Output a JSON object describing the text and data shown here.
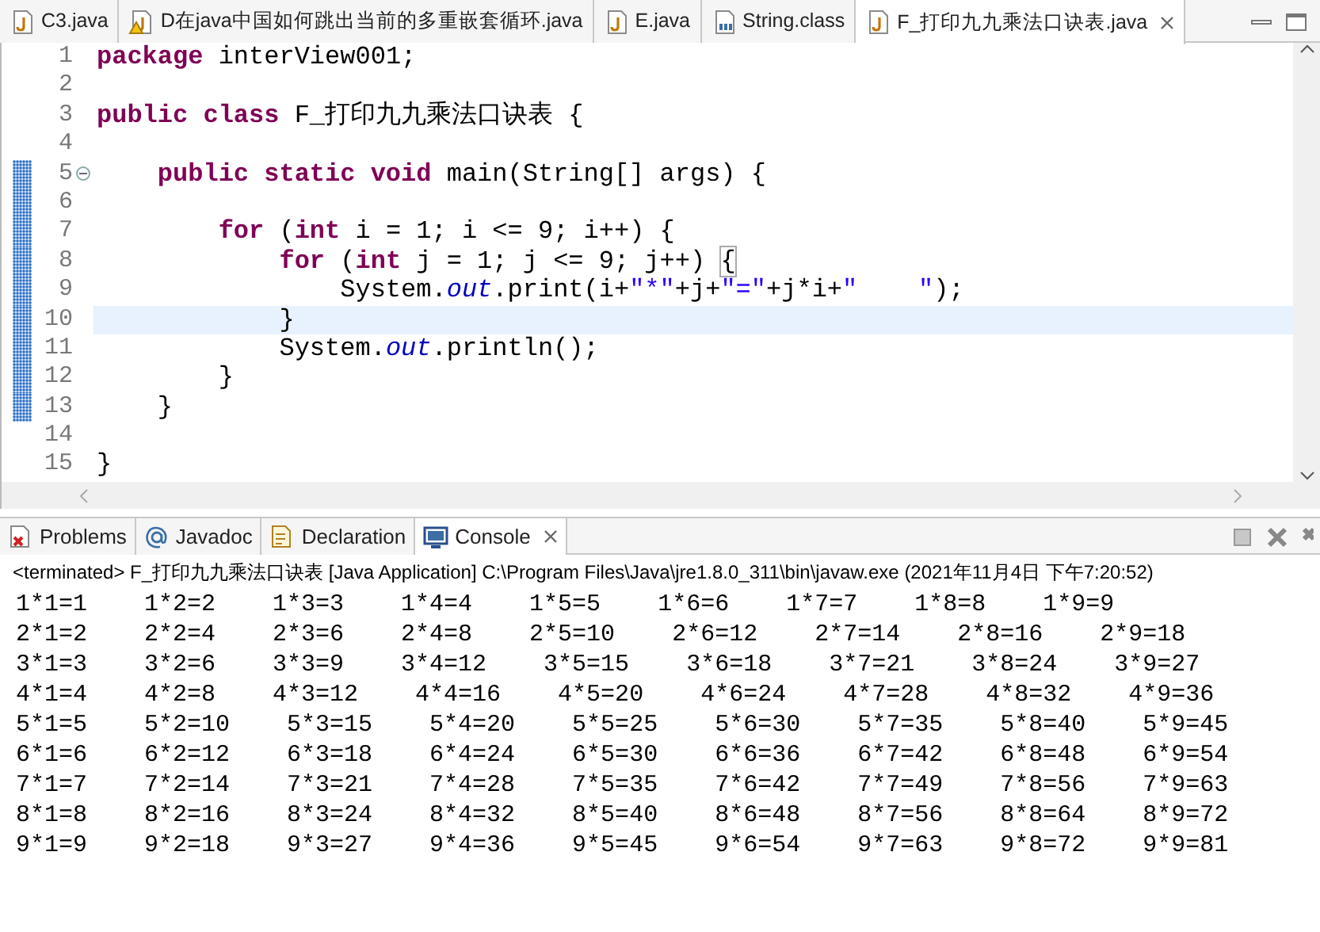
{
  "editor_tabs": [
    {
      "label": "C3.java",
      "kind": "java",
      "selected": false
    },
    {
      "label": "D在java中国如何跳出当前的多重嵌套循环.java",
      "kind": "java-warning",
      "selected": false
    },
    {
      "label": "E.java",
      "kind": "java",
      "selected": false
    },
    {
      "label": "String.class",
      "kind": "class",
      "selected": false
    },
    {
      "label": "F_打印九九乘法口诀表.java",
      "kind": "java",
      "selected": true
    }
  ],
  "code_lines": [
    {
      "number": "1",
      "selected": false,
      "range_marker": false,
      "tokens": [
        {
          "kind": "keyword",
          "text": "package"
        },
        {
          "kind": "plain",
          "text": " interView001;"
        }
      ]
    },
    {
      "number": "2",
      "selected": false,
      "range_marker": false
    },
    {
      "number": "3",
      "selected": false,
      "range_marker": false,
      "tokens": [
        {
          "kind": "keyword",
          "text": "public class"
        },
        {
          "kind": "plain",
          "text": " F_打印九九乘法口诀表 {"
        }
      ]
    },
    {
      "number": "4",
      "selected": false,
      "range_marker": false
    },
    {
      "number": "5",
      "selected": false,
      "range_marker": true,
      "expanded": true,
      "tokens": [
        {
          "kind": "keyword",
          "text": "    public static void"
        },
        {
          "kind": "plain",
          "text": " main(String[] args) {"
        }
      ]
    },
    {
      "number": "6",
      "selected": false,
      "range_marker": true
    },
    {
      "number": "7",
      "selected": false,
      "range_marker": true,
      "tokens": [
        {
          "kind": "keyword",
          "text": "        for"
        },
        {
          "kind": "plain",
          "text": " ("
        },
        {
          "kind": "keyword",
          "text": "int"
        },
        {
          "kind": "plain",
          "text": " i = 1; i <= 9; i++) {"
        }
      ]
    },
    {
      "number": "8",
      "selected": false,
      "range_marker": true,
      "tokens": [
        {
          "kind": "keyword",
          "text": "            for"
        },
        {
          "kind": "plain",
          "text": " ("
        },
        {
          "kind": "keyword",
          "text": "int"
        },
        {
          "kind": "plain",
          "text": " j = 1; j <= 9; j++) "
        },
        {
          "kind": "bracket_match",
          "text": "{"
        }
      ]
    },
    {
      "number": "9",
      "selected": false,
      "range_marker": true,
      "tokens": [
        {
          "kind": "plain",
          "text": "                System."
        },
        {
          "kind": "field",
          "text": "out"
        },
        {
          "kind": "plain",
          "text": ".print(i+"
        },
        {
          "kind": "string",
          "text": "\"*\""
        },
        {
          "kind": "plain",
          "text": "+j+"
        },
        {
          "kind": "string",
          "text": "\"=\""
        },
        {
          "kind": "plain",
          "text": "+j*i+"
        },
        {
          "kind": "string",
          "text": "\"    \""
        },
        {
          "kind": "plain",
          "text": ");"
        }
      ]
    },
    {
      "number": "10",
      "selected": true,
      "range_marker": true,
      "tokens": [
        {
          "kind": "plain",
          "text": "            }"
        }
      ]
    },
    {
      "number": "11",
      "selected": false,
      "range_marker": true,
      "tokens": [
        {
          "kind": "plain",
          "text": "            System."
        },
        {
          "kind": "field",
          "text": "out"
        },
        {
          "kind": "plain",
          "text": ".println();"
        }
      ]
    },
    {
      "number": "12",
      "selected": false,
      "range_marker": true,
      "tokens": [
        {
          "kind": "plain",
          "text": "        }"
        }
      ]
    },
    {
      "number": "13",
      "selected": false,
      "range_marker": true,
      "tokens": [
        {
          "kind": "plain",
          "text": "    }"
        }
      ]
    },
    {
      "number": "14",
      "selected": false,
      "range_marker": false
    },
    {
      "number": "15",
      "selected": false,
      "range_marker": false,
      "tokens": [
        {
          "kind": "plain",
          "text": "}"
        }
      ]
    }
  ],
  "console_tabs": [
    {
      "label": "Problems",
      "kind": "problems",
      "selected": false
    },
    {
      "label": "Javadoc",
      "kind": "javadoc",
      "selected": false
    },
    {
      "label": "Declaration",
      "kind": "declaration",
      "selected": false
    },
    {
      "label": "Console",
      "kind": "console",
      "selected": true
    }
  ],
  "console_header": "<terminated> F_打印九九乘法口诀表 [Java Application] C:\\Program Files\\Java\\jre1.8.0_311\\bin\\javaw.exe (2021年11月4日 下午7:20:52)",
  "console_output": [
    "1*1=1    1*2=2    1*3=3    1*4=4    1*5=5    1*6=6    1*7=7    1*8=8    1*9=9",
    "2*1=2    2*2=4    2*3=6    2*4=8    2*5=10    2*6=12    2*7=14    2*8=16    2*9=18",
    "3*1=3    3*2=6    3*3=9    3*4=12    3*5=15    3*6=18    3*7=21    3*8=24    3*9=27",
    "4*1=4    4*2=8    4*3=12    4*4=16    4*5=20    4*6=24    4*7=28    4*8=32    4*9=36",
    "5*1=5    5*2=10    5*3=15    5*4=20    5*5=25    5*6=30    5*7=35    5*8=40    5*9=45",
    "6*1=6    6*2=12    6*3=18    6*4=24    6*5=30    6*6=36    6*7=42    6*8=48    6*9=54",
    "7*1=7    7*2=14    7*3=21    7*4=28    7*5=35    7*6=42    7*7=49    7*8=56    7*9=63",
    "8*1=8    8*2=16    8*3=24    8*4=32    8*5=40    8*6=48    8*7=56    8*8=64    8*9=72",
    "9*1=9    9*2=18    9*3=27    9*4=36    9*5=45    9*6=54    9*7=63    9*8=72    9*9=81"
  ]
}
